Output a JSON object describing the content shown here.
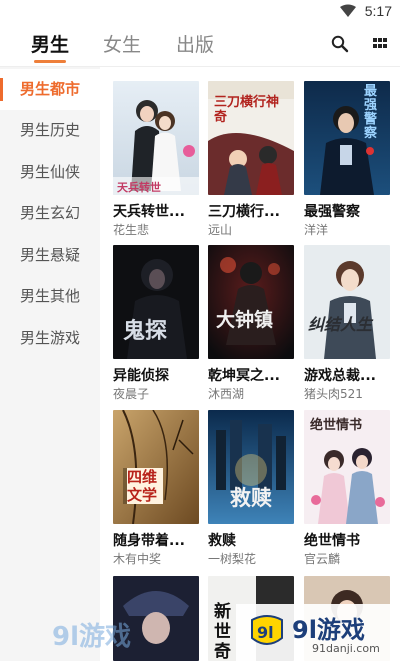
{
  "status": {
    "time": "5:17"
  },
  "header": {
    "tabs": [
      {
        "label": "男生",
        "active": true
      },
      {
        "label": "女生",
        "active": false
      },
      {
        "label": "出版",
        "active": false
      }
    ],
    "accent_color": "#ee7f3a"
  },
  "sidebar": {
    "items": [
      {
        "label": "男生都市",
        "active": true
      },
      {
        "label": "男生历史",
        "active": false
      },
      {
        "label": "男生仙侠",
        "active": false
      },
      {
        "label": "男生玄幻",
        "active": false
      },
      {
        "label": "男生悬疑",
        "active": false
      },
      {
        "label": "男生其他",
        "active": false
      },
      {
        "label": "男生游戏",
        "active": false
      }
    ]
  },
  "books": [
    {
      "title": "天兵转世...",
      "author": "花生悲",
      "cover_text": "天兵转世"
    },
    {
      "title": "三刀横行...",
      "author": "远山",
      "cover_text": "三刀横行神奇"
    },
    {
      "title": "最强警察",
      "author": "洋洋",
      "cover_text": "最强警察"
    },
    {
      "title": "异能侦探",
      "author": "夜晨子",
      "cover_text": "鬼探"
    },
    {
      "title": "乾坤冥之...",
      "author": "沐西湖",
      "cover_text": "大钟镇"
    },
    {
      "title": "游戏总裁...",
      "author": "猪头肉521",
      "cover_text": "纠结人生"
    },
    {
      "title": "随身带着...",
      "author": "木有中奖",
      "cover_text": "四维文学"
    },
    {
      "title": "救赎",
      "author": "一树梨花",
      "cover_text": "救赎"
    },
    {
      "title": "绝世情书",
      "author": "官云麟",
      "cover_text": "绝世情书"
    },
    {
      "title": "",
      "author": "",
      "cover_text": ""
    },
    {
      "title": "",
      "author": "",
      "cover_text": "新世奇侠"
    },
    {
      "title": "",
      "author": "",
      "cover_text": ""
    }
  ],
  "watermark": {
    "logo": "9l游戏",
    "url": "91danji.com"
  }
}
